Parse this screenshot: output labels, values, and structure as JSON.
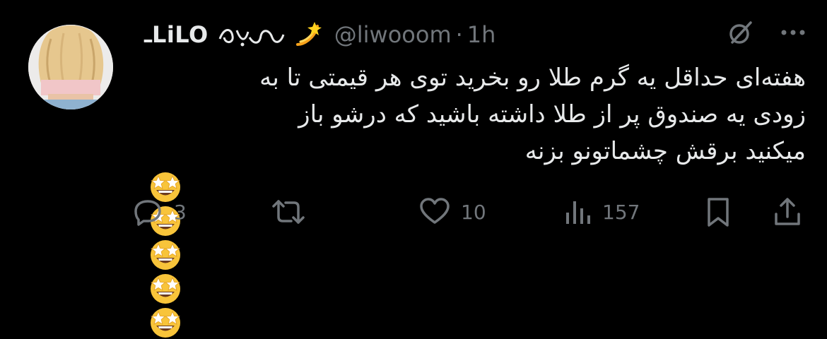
{
  "author": {
    "display_name": "ـLiLO",
    "handle": "@liwooom",
    "separator": "·",
    "time": "1h"
  },
  "tweet": {
    "lines": [
      "هفته‌ای حداقل یه گرم طلا رو بخرید توی هر قیمتی تا به",
      "زودی یه صندوق پر از طلا داشته باشید که درشو باز",
      "میکنید برقش چشماتونو بزنه"
    ],
    "emoji": [
      "star-struck",
      "star-struck",
      "star-struck",
      "star-struck",
      "star-struck"
    ]
  },
  "actions": {
    "reply_count": "3",
    "retweet_count": "",
    "like_count": "10",
    "view_count": "157"
  },
  "icons": {
    "grok": "grok-icon",
    "more": "more-icon",
    "reply": "reply-icon",
    "retweet": "retweet-icon",
    "like": "heart-icon",
    "views": "views-icon",
    "bookmark": "bookmark-icon",
    "share": "share-icon"
  },
  "colors": {
    "background": "#000000",
    "text": "#e7e9ea",
    "muted": "#71767b",
    "emoji_face": "#f8c43a"
  }
}
